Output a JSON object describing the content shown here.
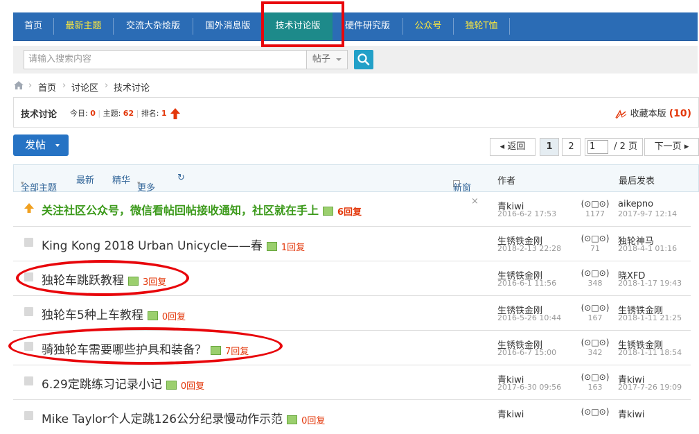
{
  "nav": {
    "items": [
      {
        "label": "首页",
        "style": "normal"
      },
      {
        "label": "最新主题",
        "style": "yellow"
      },
      {
        "label": "交流大杂烩版",
        "style": "normal"
      },
      {
        "label": "国外消息版",
        "style": "normal"
      },
      {
        "label": "技术讨论版",
        "style": "active"
      },
      {
        "label": "硬件研究版",
        "style": "normal"
      },
      {
        "label": "公众号",
        "style": "yellow"
      },
      {
        "label": "独轮T恤",
        "style": "yellow"
      }
    ]
  },
  "search": {
    "placeholder": "请输入搜索内容",
    "type": "帖子"
  },
  "breadcrumb": {
    "items": [
      "首页",
      "讨论区",
      "技术讨论"
    ]
  },
  "forum": {
    "name": "技术讨论",
    "today_label": "今日:",
    "today": "0",
    "threads_label": "主题:",
    "threads": "62",
    "rank_label": "排名:",
    "rank": "1",
    "fav_label": "收藏本版",
    "fav_count": "(10)"
  },
  "post_button": "发帖",
  "pager": {
    "back": "返回",
    "page1": "1",
    "page2": "2",
    "input": "1",
    "total": "/ 2 页",
    "next": "下一页"
  },
  "list_header": {
    "all": "全部主题",
    "latest": "最新",
    "digest": "精华",
    "more": "更多",
    "newwin": "新窗",
    "author": "作者",
    "last": "最后发表"
  },
  "threads": [
    {
      "title": "关注社区公众号，微信看帖回帖接收通知，社区就在手上",
      "replies": "6回复",
      "author": "青kiwi",
      "date": "2016-6-2 17:53",
      "views_icon": "(⊙□⊙)",
      "views": "1177",
      "last_user": "aikepno",
      "last_date": "2017-9-7 12:14",
      "hot": true
    },
    {
      "title": "King Kong 2018 Urban Unicycle——春",
      "replies": "1回复",
      "author": "生锈铁金刚",
      "date": "2018-2-13 22:28",
      "views_icon": "(⊙□⊙)",
      "views": "71",
      "last_user": "独轮神马",
      "last_date": "2018-4-1 01:16",
      "hot": false
    },
    {
      "title": "独轮车跳跃教程",
      "replies": "3回复",
      "author": "生锈铁金刚",
      "date": "2016-6-1 11:56",
      "views_icon": "(⊙□⊙)",
      "views": "348",
      "last_user": "晓XFD",
      "last_date": "2018-1-17 19:43",
      "hot": false
    },
    {
      "title": "独轮车5种上车教程",
      "replies": "0回复",
      "author": "生锈铁金刚",
      "date": "2016-5-26 10:44",
      "views_icon": "(⊙□⊙)",
      "views": "167",
      "last_user": "生锈铁金刚",
      "last_date": "2018-1-11 21:25",
      "hot": false
    },
    {
      "title": "骑独轮车需要哪些护具和装备？",
      "replies": "7回复",
      "author": "生锈铁金刚",
      "date": "2016-6-7 15:00",
      "views_icon": "(⊙□⊙)",
      "views": "342",
      "last_user": "生锈铁金刚",
      "last_date": "2018-1-11 18:54",
      "hot": false
    },
    {
      "title": "6.29定跳练习记录小记",
      "replies": "0回复",
      "author": "青kiwi",
      "date": "2017-6-30 09:56",
      "views_icon": "(⊙□⊙)",
      "views": "163",
      "last_user": "青kiwi",
      "last_date": "2017-7-26 19:09",
      "hot": false
    },
    {
      "title": "Mike Taylor个人定跳126公分纪录慢动作示范",
      "replies": "0回复",
      "author": "青kiwi",
      "date": "",
      "views_icon": "(⊙□⊙)",
      "views": "",
      "last_user": "青kiwi",
      "last_date": "",
      "hot": false
    }
  ]
}
